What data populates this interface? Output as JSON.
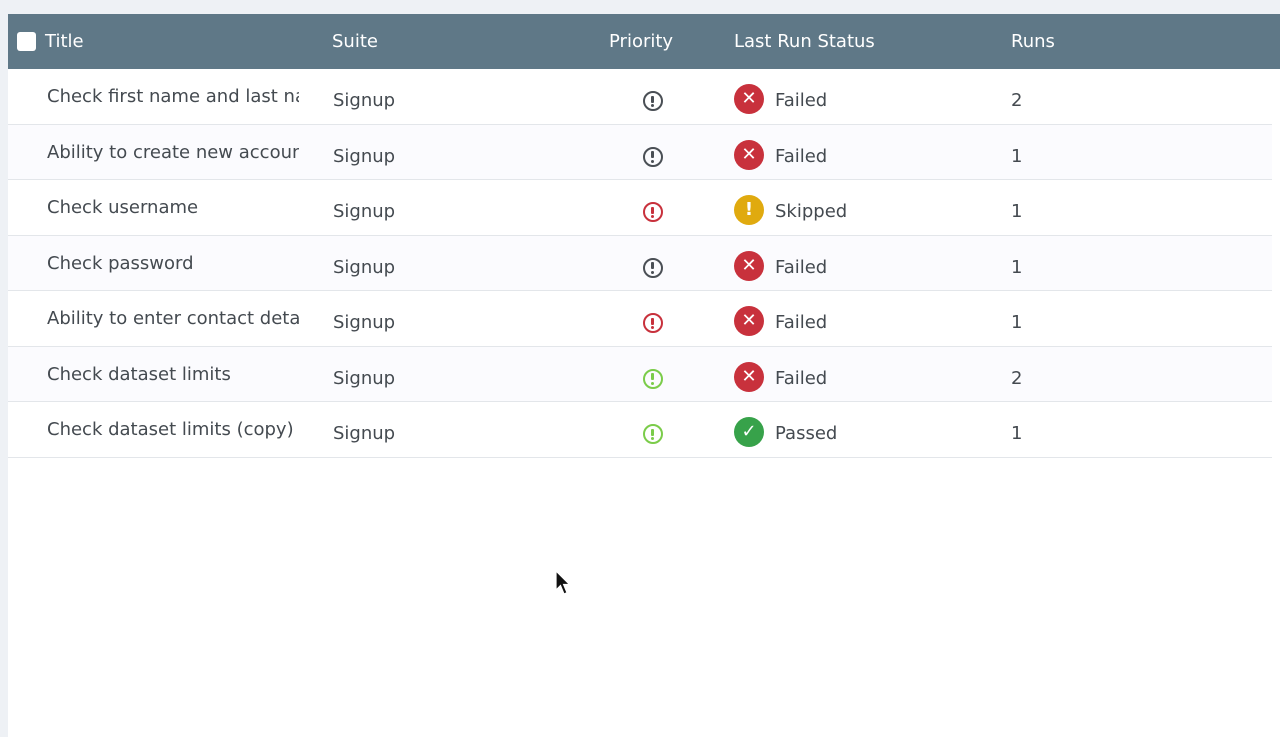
{
  "table": {
    "columns": {
      "title": "Title",
      "suite": "Suite",
      "priority": "Priority",
      "last_run_status": "Last Run Status",
      "runs": "Runs"
    },
    "rows": [
      {
        "title": "Check first name and last na",
        "suite": "Signup",
        "priority": "normal",
        "status": "Failed",
        "status_icon": "failed-icon",
        "runs": "2"
      },
      {
        "title": "Ability to create new accoun",
        "suite": "Signup",
        "priority": "normal",
        "status": "Failed",
        "status_icon": "failed-icon",
        "runs": "1"
      },
      {
        "title": "Check username",
        "suite": "Signup",
        "priority": "high",
        "status": "Skipped",
        "status_icon": "skipped-icon",
        "runs": "1"
      },
      {
        "title": "Check password",
        "suite": "Signup",
        "priority": "normal",
        "status": "Failed",
        "status_icon": "failed-icon",
        "runs": "1"
      },
      {
        "title": "Ability to enter contact detai",
        "suite": "Signup",
        "priority": "high",
        "status": "Failed",
        "status_icon": "failed-icon",
        "runs": "1"
      },
      {
        "title": "Check dataset limits",
        "suite": "Signup",
        "priority": "low",
        "status": "Failed",
        "status_icon": "failed-icon",
        "runs": "2"
      },
      {
        "title": "Check dataset limits (copy)",
        "suite": "Signup",
        "priority": "low",
        "status": "Passed",
        "status_icon": "passed-icon",
        "runs": "1"
      }
    ]
  },
  "colors": {
    "header_bg": "#5f7887",
    "failed": "#c8313c",
    "skipped": "#e0aa0f",
    "passed": "#37a24a",
    "priority_normal": "#4a4f55",
    "priority_high": "#c8313c",
    "priority_low": "#7bcc4a"
  }
}
